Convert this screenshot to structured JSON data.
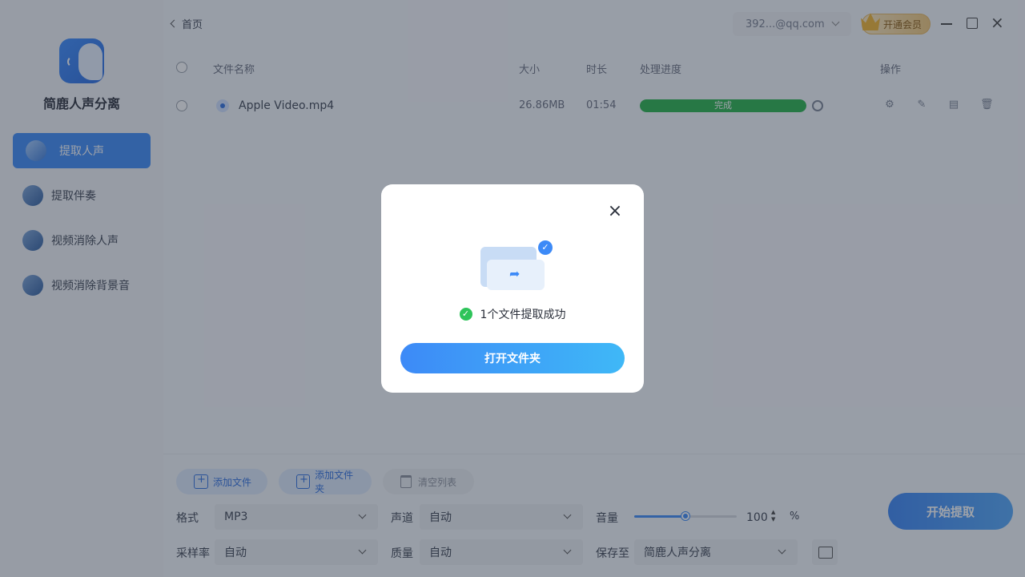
{
  "app": {
    "name": "简鹿人声分离"
  },
  "sidebar": {
    "items": [
      {
        "label": "提取人声",
        "active": true
      },
      {
        "label": "提取伴奏",
        "active": false
      },
      {
        "label": "视频消除人声",
        "active": false
      },
      {
        "label": "视频消除背景音",
        "active": false
      }
    ]
  },
  "topbar": {
    "back_label": "首页",
    "account": "392...@qq.com",
    "vip_label": "开通会员"
  },
  "table": {
    "headers": {
      "name": "文件名称",
      "size": "大小",
      "duration": "时长",
      "progress": "处理进度",
      "actions": "操作"
    },
    "rows": [
      {
        "name": "Apple Video.mp4",
        "size": "26.86MB",
        "duration": "01:54",
        "status": "完成",
        "progress": 1.0
      }
    ]
  },
  "bottom": {
    "add_file": "添加文件",
    "add_folder": "添加文件夹",
    "clear_list": "清空列表",
    "format_label": "格式",
    "format_value": "MP3",
    "channel_label": "声道",
    "channel_value": "自动",
    "volume_label": "音量",
    "volume_value": "100",
    "volume_level": 0.5,
    "volume_unit": "%",
    "samplerate_label": "采样率",
    "samplerate_value": "自动",
    "quality_label": "质量",
    "quality_value": "自动",
    "saveto_label": "保存至",
    "saveto_value": "简鹿人声分离",
    "start_label": "开始提取"
  },
  "modal": {
    "message": "1个文件提取成功",
    "open_folder": "打开文件夹"
  },
  "colors": {
    "accent": "#3d8af7",
    "success": "#27b24a"
  }
}
